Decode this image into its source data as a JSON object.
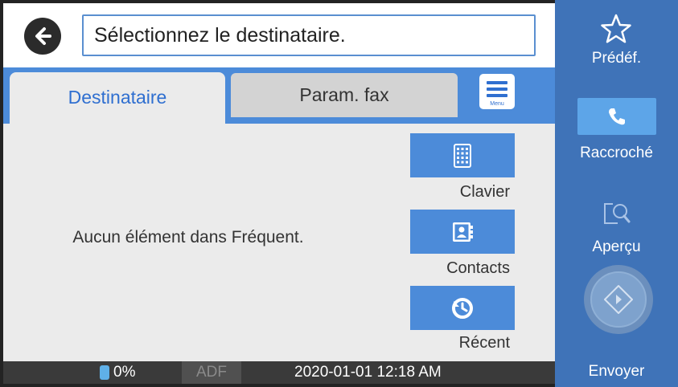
{
  "header": {
    "prompt": "Sélectionnez le destinataire."
  },
  "tabs": [
    {
      "label": "Destinataire",
      "active": true
    },
    {
      "label": "Param. fax",
      "active": false
    }
  ],
  "menu": {
    "label": "Menu"
  },
  "main": {
    "empty_message": "Aucun élément dans Fréquent."
  },
  "side_buttons": [
    {
      "label": "Clavier",
      "icon": "keypad-icon"
    },
    {
      "label": "Contacts",
      "icon": "contacts-icon"
    },
    {
      "label": "Récent",
      "icon": "clock-icon"
    }
  ],
  "status": {
    "ink_level": "0%",
    "adf": "ADF",
    "datetime": "2020-01-01 12:18 AM"
  },
  "right_panel": {
    "preset_label": "Prédéf.",
    "hangup_label": "Raccroché",
    "preview_label": "Aperçu",
    "send_label": "Envoyer"
  },
  "colors": {
    "accent": "#4c8bd9",
    "panel": "#3f73b8",
    "active_tab_text": "#2f6fd0"
  }
}
